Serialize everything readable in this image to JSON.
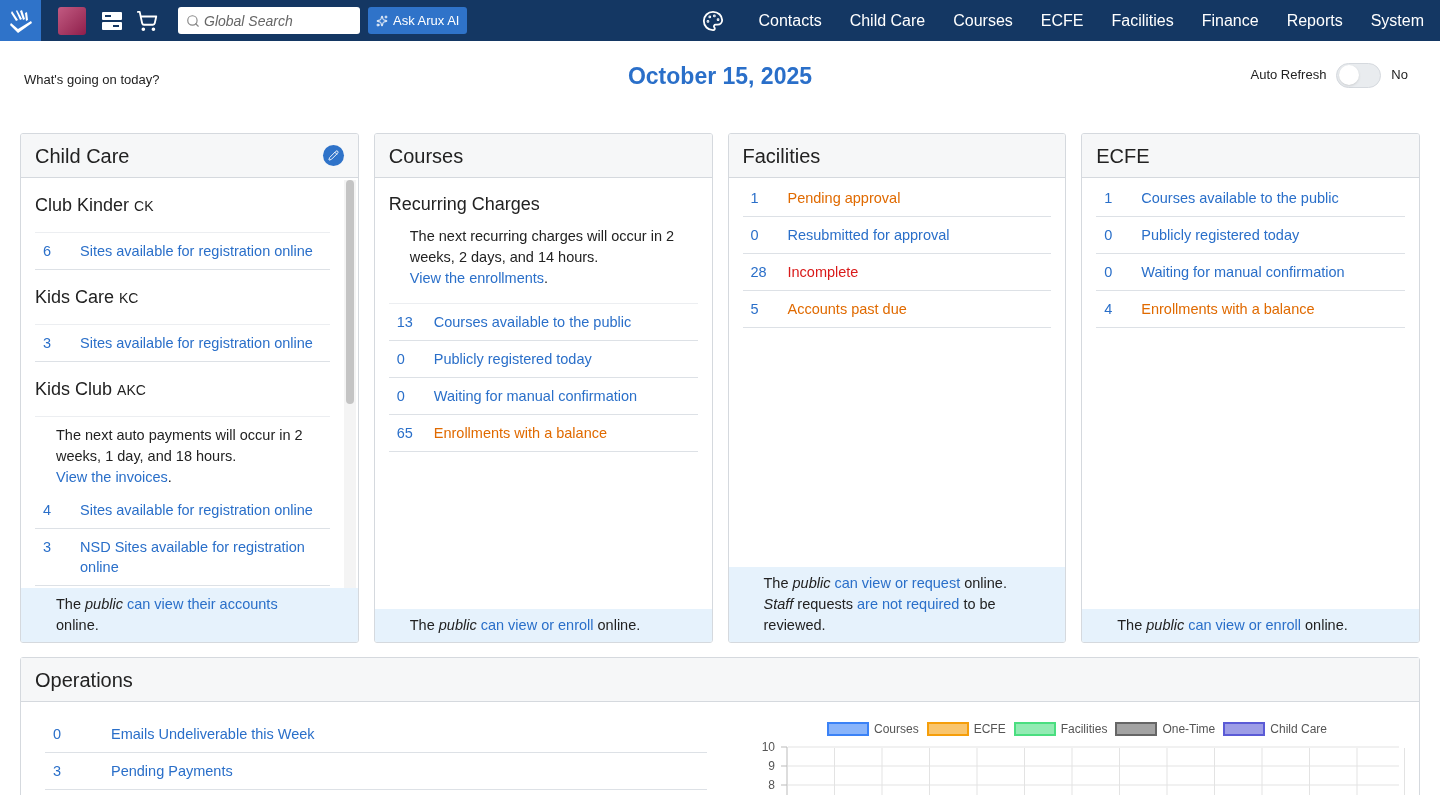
{
  "nav": {
    "search": {
      "placeholder": "Global Search"
    },
    "ai_button": "Ask Arux AI",
    "menu": [
      "Contacts",
      "Child Care",
      "Courses",
      "ECFE",
      "Facilities",
      "Finance",
      "Reports",
      "System"
    ]
  },
  "header": {
    "prompt": "What's going on today?",
    "date": "October 15, 2025",
    "auto_refresh": {
      "label": "Auto Refresh",
      "on": false,
      "value": "No"
    }
  },
  "child_care": {
    "title": "Child Care",
    "groups": [
      {
        "name": "Club Kinder",
        "code": "CK",
        "stats": [
          {
            "count": "6",
            "label": "Sites available for registration online",
            "color": "#2a6fc9"
          }
        ]
      },
      {
        "name": "Kids Care",
        "code": "KC",
        "stats": [
          {
            "count": "3",
            "label": "Sites available for registration online",
            "color": "#2a6fc9"
          }
        ]
      },
      {
        "name": "Kids Club",
        "code": "AKC",
        "note": [
          {
            "kind": "text",
            "text": "The next auto payments will occur in 2 weeks, 1 day, and 18 hours. "
          },
          {
            "kind": "link",
            "text": "View the invoices"
          },
          {
            "kind": "text",
            "text": "."
          }
        ],
        "stats": [
          {
            "count": "4",
            "label": "Sites available for registration online",
            "color": "#2a6fc9"
          },
          {
            "count": "3",
            "label": "NSD Sites available for registration online",
            "color": "#2a6fc9"
          }
        ]
      }
    ],
    "footer": [
      {
        "kind": "text",
        "text": "The "
      },
      {
        "kind": "em",
        "text": "public"
      },
      {
        "kind": "link",
        "text": "can view their accounts"
      },
      {
        "kind": "text",
        "text": " online."
      }
    ]
  },
  "courses": {
    "title": "Courses",
    "subtitle": "Recurring Charges",
    "note": [
      {
        "kind": "text",
        "text": "The next recurring charges will occur in 2 weeks, 2 days, and 14 hours. "
      },
      {
        "kind": "link",
        "text": "View the enrollments"
      },
      {
        "kind": "text",
        "text": "."
      }
    ],
    "stats": [
      {
        "count": "13",
        "label": "Courses available to the public",
        "color": "#2a6fc9"
      },
      {
        "count": "0",
        "label": "Publicly registered today",
        "color": "#2a6fc9"
      },
      {
        "count": "0",
        "label": "Waiting for manual confirmation",
        "color": "#2a6fc9"
      },
      {
        "count": "65",
        "label": "Enrollments with a balance",
        "color": "#e06a00"
      }
    ],
    "footer": [
      {
        "kind": "text",
        "text": "The "
      },
      {
        "kind": "em",
        "text": "public"
      },
      {
        "kind": "link",
        "text": "can view or enroll"
      },
      {
        "kind": "text",
        "text": " online."
      }
    ]
  },
  "facilities": {
    "title": "Facilities",
    "stats": [
      {
        "count": "1",
        "label": "Pending approval",
        "color": "#e06a00"
      },
      {
        "count": "0",
        "label": "Resubmitted for approval",
        "color": "#2a6fc9"
      },
      {
        "count": "28",
        "label": "Incomplete",
        "color": "#d91a1a"
      },
      {
        "count": "5",
        "label": "Accounts past due",
        "color": "#e06a00"
      }
    ],
    "footer": [
      {
        "kind": "text",
        "text": "The "
      },
      {
        "kind": "em",
        "text": "public"
      },
      {
        "kind": "link",
        "text": "can view or request"
      },
      {
        "kind": "text",
        "text": " online. "
      },
      {
        "kind": "em",
        "text": "Staff"
      },
      {
        "kind": "text",
        "text": " requests "
      },
      {
        "kind": "link",
        "text": "are not required"
      },
      {
        "kind": "text",
        "text": " to be reviewed."
      }
    ]
  },
  "ecfe": {
    "title": "ECFE",
    "stats": [
      {
        "count": "1",
        "label": "Courses available to the public",
        "color": "#2a6fc9"
      },
      {
        "count": "0",
        "label": "Publicly registered today",
        "color": "#2a6fc9"
      },
      {
        "count": "0",
        "label": "Waiting for manual confirmation",
        "color": "#2a6fc9"
      },
      {
        "count": "4",
        "label": "Enrollments with a balance",
        "color": "#e06a00"
      }
    ],
    "footer": [
      {
        "kind": "text",
        "text": "The "
      },
      {
        "kind": "em",
        "text": "public"
      },
      {
        "kind": "link",
        "text": "can view or enroll"
      },
      {
        "kind": "text",
        "text": " online."
      }
    ]
  },
  "operations": {
    "title": "Operations",
    "stats": [
      {
        "count": "0",
        "label": "Emails Undeliverable this Week",
        "color": "#2a6fc9"
      },
      {
        "count": "3",
        "label": "Pending Payments",
        "color": "#2a6fc9"
      }
    ],
    "y_axis_labels": [
      "10",
      "9",
      "8"
    ],
    "chart_data": {
      "type": "other",
      "series": [
        {
          "name": "Courses",
          "color": "#3b82f6"
        },
        {
          "name": "ECFE",
          "color": "#f59e0b"
        },
        {
          "name": "Facilities",
          "color": "#4ade80"
        },
        {
          "name": "One-Time",
          "color": "#666666"
        },
        {
          "name": "Child Care",
          "color": "#5b5bd6"
        }
      ]
    }
  }
}
